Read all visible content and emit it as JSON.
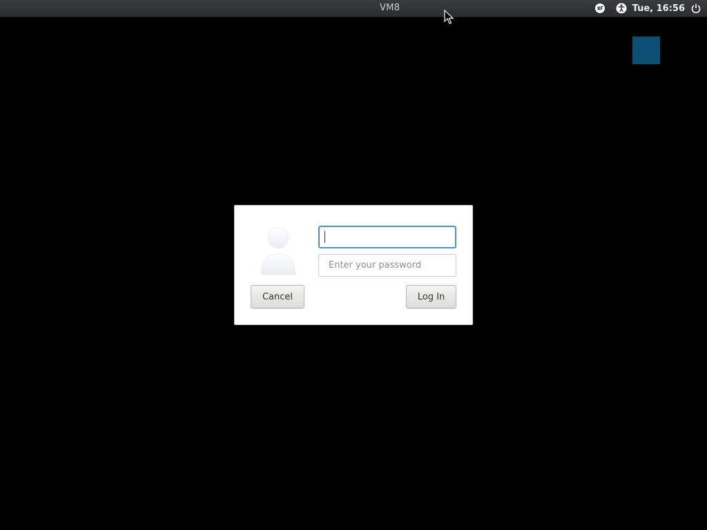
{
  "topbar": {
    "host_name": "VM8",
    "clock": "Tue, 16:56",
    "icons": [
      "keyboard-layout-icon",
      "accessibility-icon",
      "power-icon"
    ]
  },
  "login_dialog": {
    "username": {
      "value": "",
      "placeholder": ""
    },
    "password": {
      "value": "",
      "placeholder": "Enter your password"
    },
    "cancel_label": "Cancel",
    "login_label": "Log In"
  },
  "colors": {
    "background": "#000000",
    "topbar": "#2e3031",
    "focus_accent": "#4a90d9",
    "square": "#0b4f75"
  }
}
